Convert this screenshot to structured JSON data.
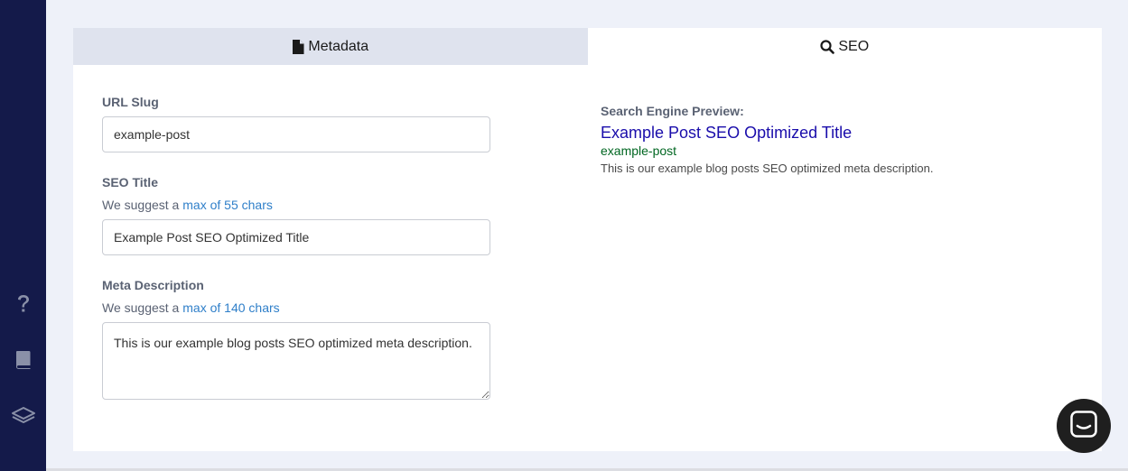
{
  "sidebar": {
    "icons": [
      "help-icon",
      "book-icon",
      "layers-icon"
    ],
    "background": "#141a4a"
  },
  "tabs": [
    {
      "label": "Metadata",
      "icon": "file-icon",
      "active": false
    },
    {
      "label": "SEO",
      "icon": "search-icon",
      "active": true
    }
  ],
  "form": {
    "url_slug": {
      "label": "URL Slug",
      "value": "example-post"
    },
    "seo_title": {
      "label": "SEO Title",
      "hint_prefix": "We suggest a ",
      "hint_link": "max of 55 chars",
      "value": "Example Post SEO Optimized Title"
    },
    "meta_description": {
      "label": "Meta Description",
      "hint_prefix": "We suggest a ",
      "hint_link": "max of 140 chars",
      "value": "This is our example blog posts SEO optimized meta description."
    }
  },
  "preview": {
    "label": "Search Engine Preview:",
    "title": "Example Post SEO Optimized Title",
    "url": "example-post",
    "description": "This is our example blog posts SEO optimized meta description."
  },
  "colors": {
    "accent_link": "#2f7fc9",
    "preview_title": "#1a0dab",
    "preview_url": "#006621",
    "page_bg": "#eef1f9"
  }
}
